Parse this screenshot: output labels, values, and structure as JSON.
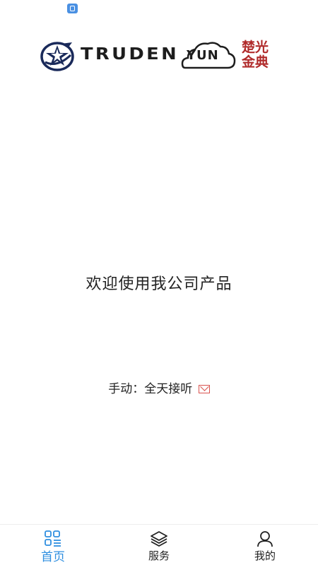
{
  "logo": {
    "wordmark": "TRUDEN",
    "cloud_text": "YUN",
    "seal_line1": "楚光",
    "seal_line2": "金典"
  },
  "main": {
    "welcome_text": "欢迎使用我公司产品",
    "manual_text": "手动：全天接听"
  },
  "tabbar": {
    "active_color": "#2f8fe0",
    "inactive_color": "#222222",
    "tabs": [
      {
        "label": "首页",
        "icon": "grid-icon",
        "active": true
      },
      {
        "label": "服务",
        "icon": "layers-icon",
        "active": false
      },
      {
        "label": "我的",
        "icon": "person-icon",
        "active": false
      }
    ]
  }
}
